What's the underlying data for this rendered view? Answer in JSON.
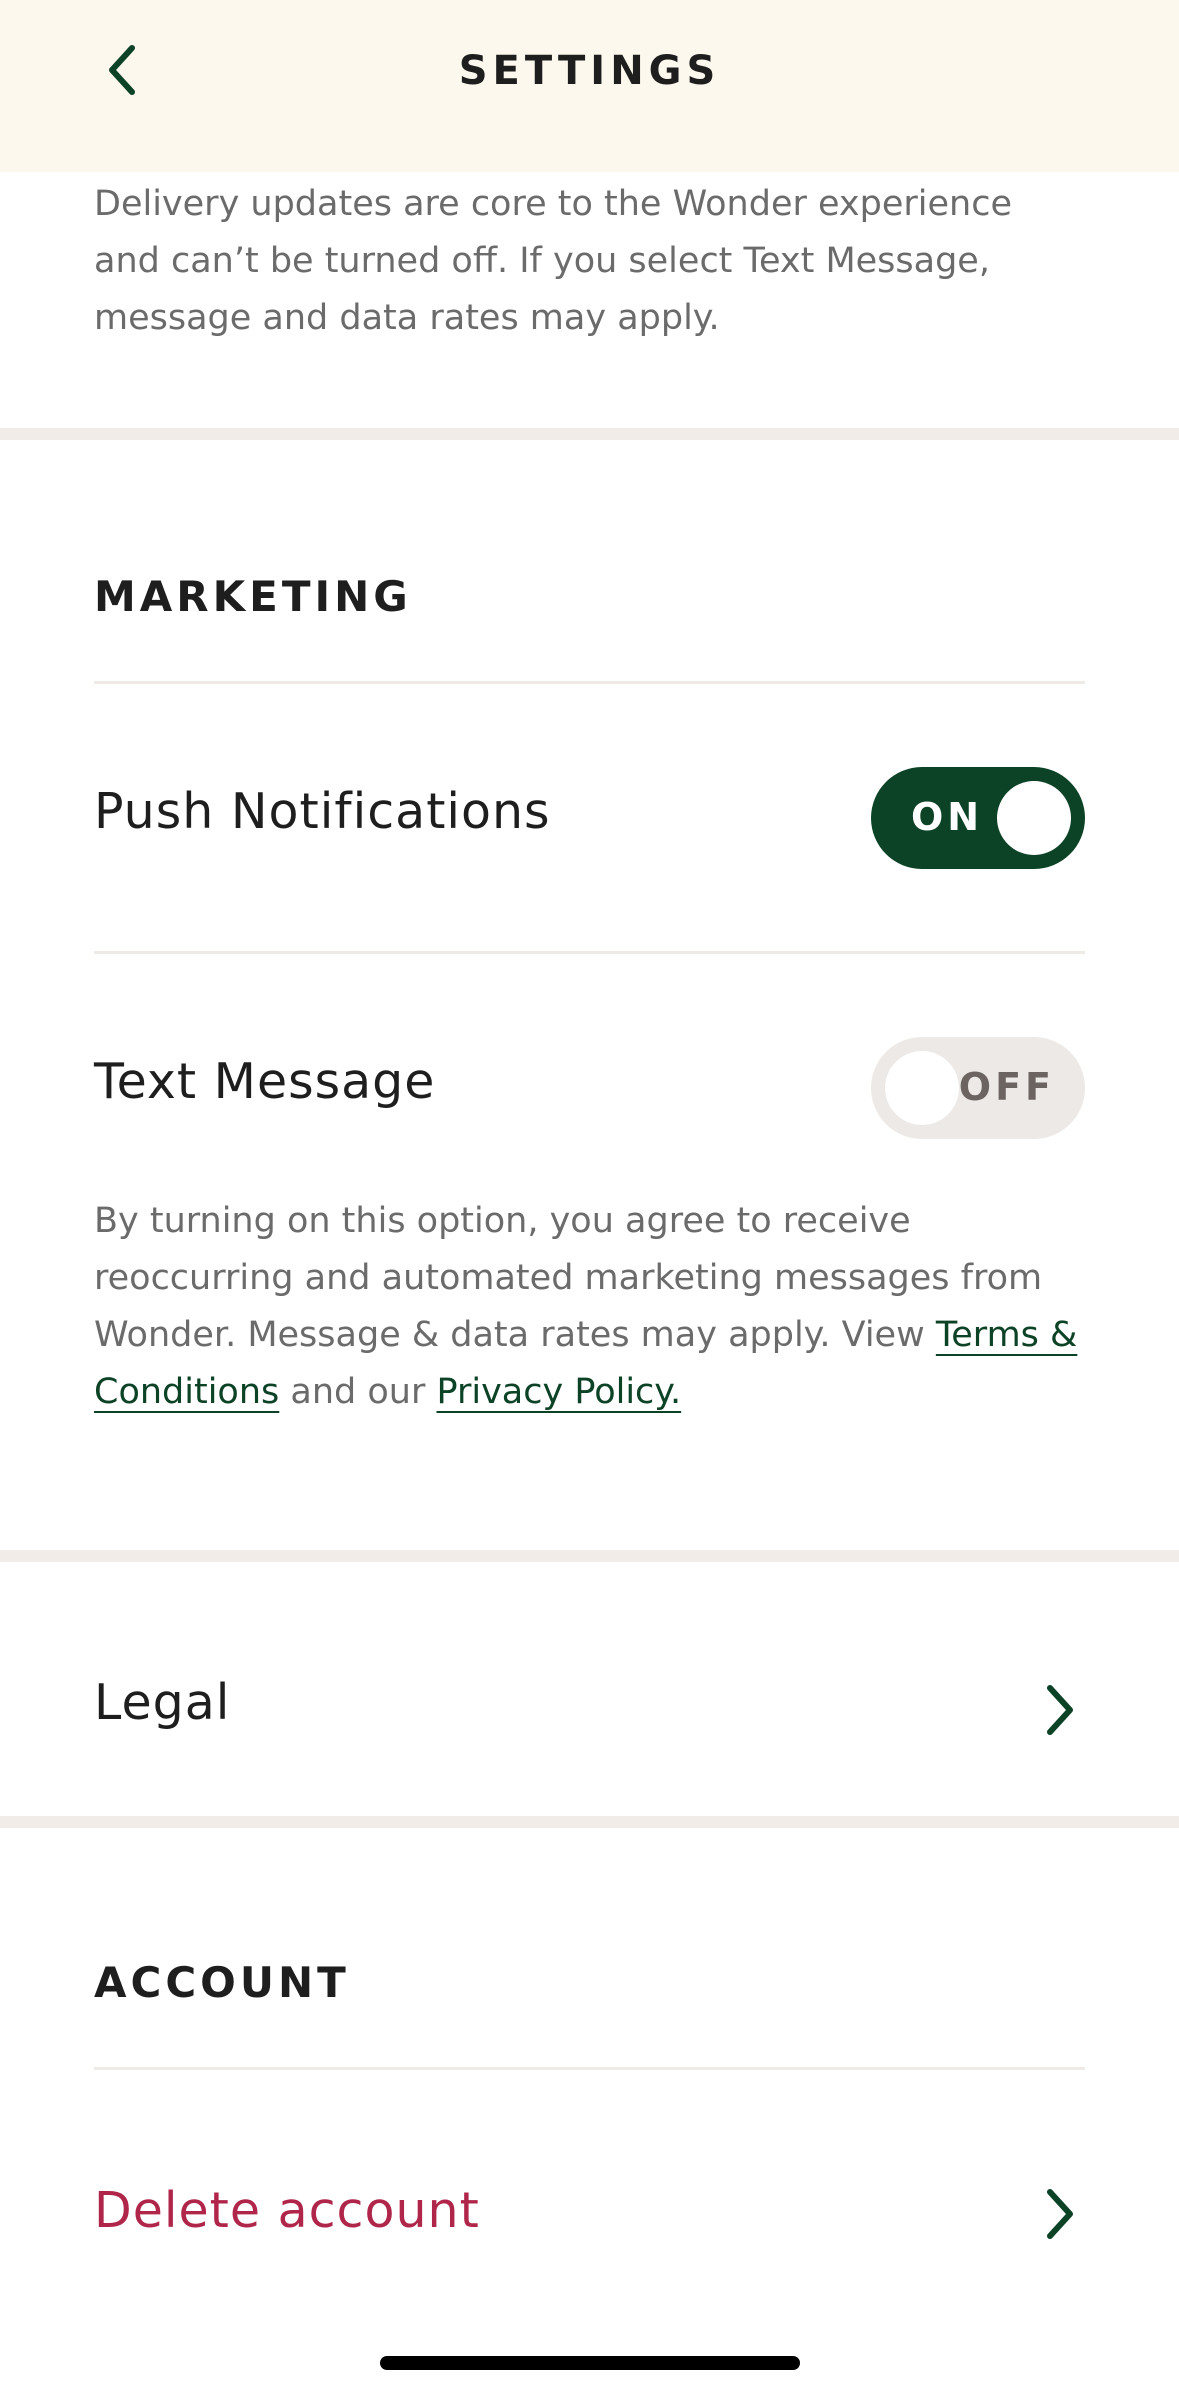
{
  "header": {
    "title": "SETTINGS",
    "back_icon": "chevron-left-icon"
  },
  "delivery": {
    "description": "Delivery updates are core to the Wonder experience and can’t be turned off. If you select Text Message, message and data rates may apply."
  },
  "marketing": {
    "title": "MARKETING",
    "push": {
      "label": "Push Notifications",
      "state": "ON",
      "enabled": true
    },
    "text": {
      "label": "Text Message",
      "state": "OFF",
      "enabled": false
    },
    "consent": {
      "prefix": "By turning on this option, you agree to receive reoccurring and automated marketing messages from Wonder. Message & data rates may apply. View ",
      "terms_link": "Terms & Conditions",
      "middle": " and our ",
      "privacy_link": "Privacy Policy."
    }
  },
  "legal": {
    "label": "Legal",
    "icon": "chevron-right-icon"
  },
  "account": {
    "title": "ACCOUNT",
    "delete": {
      "label": "Delete account",
      "icon": "chevron-right-icon"
    }
  },
  "colors": {
    "header_bg": "#fcf8ee",
    "brand_green": "#0c4226",
    "danger": "#b0254a",
    "toggle_off": "#ece9e6",
    "divider": "#f1ece7"
  }
}
